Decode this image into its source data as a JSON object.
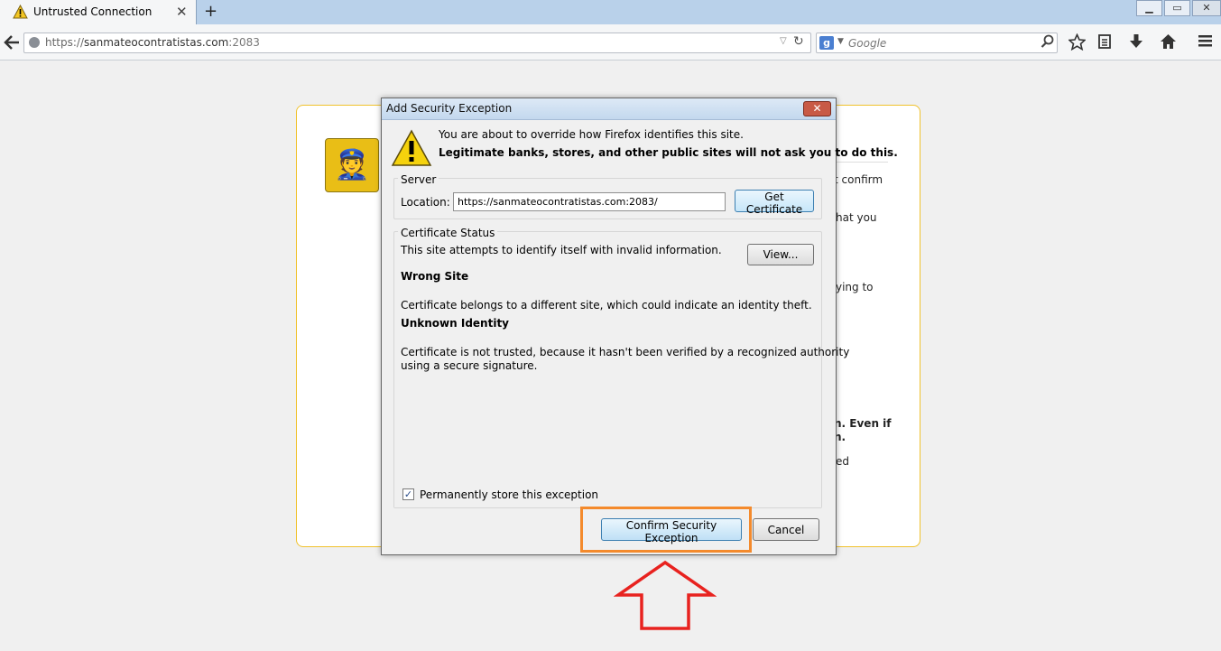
{
  "browser": {
    "tab_title": "Untrusted Connection",
    "tab_close": "✕",
    "new_tab": "+",
    "window_buttons": {
      "minimize": "▁",
      "maximize": "▭",
      "close": "✕"
    },
    "url_prefix": "https://",
    "url_host": "sanmateocontratistas.com",
    "url_port": ":2083",
    "search_engine_letter": "g",
    "search_placeholder": "Google",
    "icons": [
      "back-icon",
      "globe-icon",
      "reload-icon",
      "search-icon",
      "bookmark-star-icon",
      "reading-list-icon",
      "download-icon",
      "home-icon",
      "menu-icon"
    ]
  },
  "background_page": {
    "fragments": [
      {
        "text": "t confirm",
        "bold": false
      },
      {
        "text": "hat you",
        "bold": false
      },
      {
        "text": "ying to",
        "bold": false
      },
      {
        "text": "n. Even if",
        "bold": true
      },
      {
        "text": "n.",
        "bold": true
      },
      {
        "text": "ed",
        "bold": false
      }
    ]
  },
  "dialog": {
    "title": "Add Security Exception",
    "close": "✕",
    "message_line1": "You are about to override how Firefox identifies this site.",
    "message_line2": "Legitimate banks, stores, and other public sites will not ask you to do this.",
    "server": {
      "group_label": "Server",
      "location_label": "Location:",
      "location_value": "https://sanmateocontratistas.com:2083/",
      "get_certificate": "Get Certificate"
    },
    "status": {
      "group_label": "Certificate Status",
      "intro": "This site attempts to identify itself with invalid information.",
      "view_button": "View...",
      "wrong_site_heading": "Wrong Site",
      "wrong_site_text": "Certificate belongs to a different site, which could indicate an identity theft.",
      "unknown_identity_heading": "Unknown Identity",
      "unknown_identity_line1": "Certificate is not trusted, because it hasn't been verified by a recognized authority",
      "unknown_identity_line2": "using a secure signature."
    },
    "permanent_label": "Permanently store this exception",
    "permanent_checked": true,
    "confirm_button": "Confirm Security Exception",
    "cancel_button": "Cancel"
  },
  "colors": {
    "highlight_box": "#f48a2c",
    "arrow": "#e8221f",
    "warning_yellow": "#f0c22d"
  }
}
